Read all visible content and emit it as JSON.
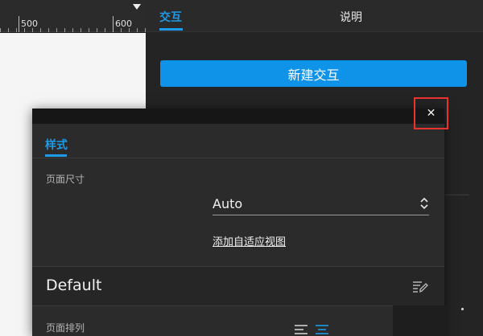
{
  "ruler": {
    "labels": [
      "500",
      "600"
    ]
  },
  "panel": {
    "tabs": [
      {
        "label": "交互",
        "active": true
      },
      {
        "label": "说明",
        "active": false
      }
    ],
    "new_interaction_button": "新建交互"
  },
  "dialog": {
    "close_glyph": "✕",
    "tab_style": "样式",
    "page_size_label": "页面尺寸",
    "page_size_value": "Auto",
    "add_adaptive_view_link": "添加自适应视图",
    "default_title": "Default",
    "page_arrange_label": "页面排列"
  },
  "icons": {
    "edit": "edit-list-icon",
    "align_left": "align-left-icon",
    "align_center": "align-center-icon",
    "dropdown_caret": "caret-down-icon",
    "select_arrows": "up-down-chevron-icon"
  },
  "colors": {
    "accent": "#1e9be8",
    "button": "#0f93e8",
    "close_highlight": "#e8332e"
  }
}
